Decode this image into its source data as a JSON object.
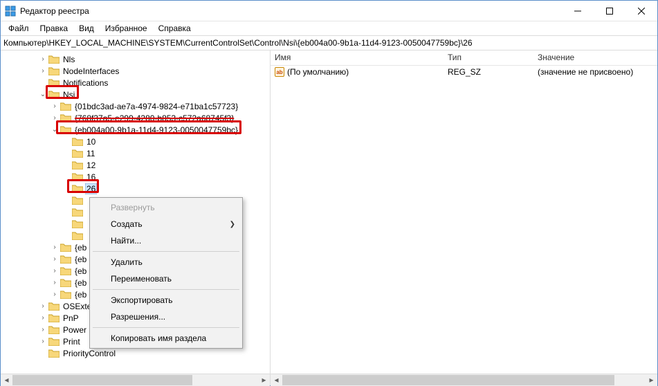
{
  "title": "Редактор реестра",
  "menu": {
    "file": "Файл",
    "edit": "Правка",
    "view": "Вид",
    "fav": "Избранное",
    "help": "Справка"
  },
  "address": "Компьютер\\HKEY_LOCAL_MACHINE\\SYSTEM\\CurrentControlSet\\Control\\Nsi\\{eb004a00-9b1a-11d4-9123-0050047759bc}\\26",
  "tree": {
    "nls": "Nls",
    "nodeInterfaces": "NodeInterfaces",
    "notifications": "Notifications",
    "nsi": "Nsi",
    "g1": "{01bdc3ad-ae7a-4974-9824-e71ba1c57723}",
    "g2": "{768f37a5-e299-4280-b853-c572a68745f3}",
    "g3": "{eb004a00-9b1a-11d4-9123-0050047759bc}",
    "n10": "10",
    "n11": "11",
    "n12": "12",
    "n16": "16",
    "n26": "26",
    "eb1": "{eb",
    "eb2": "{eb",
    "eb3": "{eb",
    "eb4": "{eb",
    "eb5": "{eb",
    "osext": "OSExte",
    "pnp": "PnP",
    "power": "Power",
    "print": "Print",
    "prio": "PriorityControl"
  },
  "listHeaders": {
    "name": "Имя",
    "type": "Тип",
    "value": "Значение"
  },
  "listRow": {
    "name": "(По умолчанию)",
    "type": "REG_SZ",
    "value": "(значение не присвоено)"
  },
  "ctx": {
    "expand": "Развернуть",
    "create": "Создать",
    "find": "Найти...",
    "delete": "Удалить",
    "rename": "Переименовать",
    "export": "Экспортировать",
    "perm": "Разрешения...",
    "copy": "Копировать имя раздела"
  }
}
